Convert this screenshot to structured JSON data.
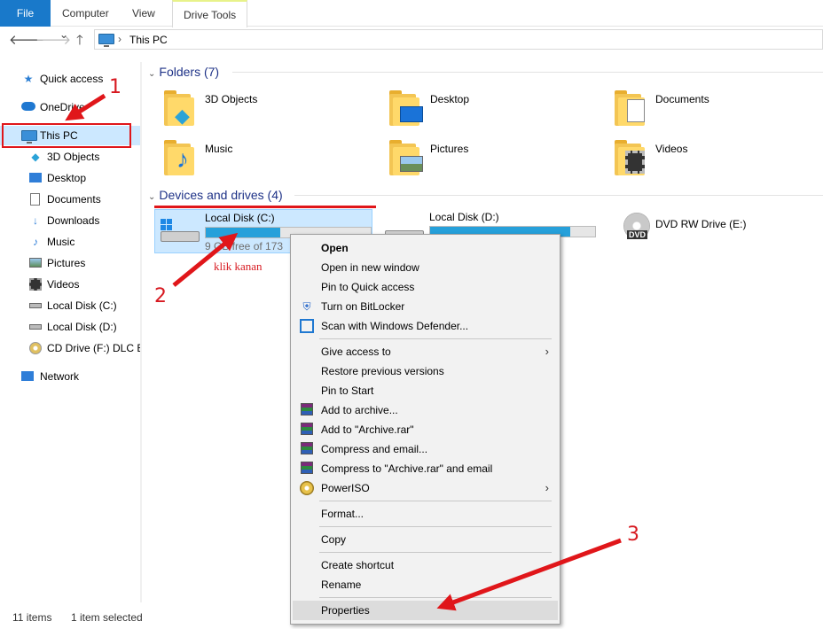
{
  "ribbon": {
    "file": "File",
    "computer": "Computer",
    "view": "View",
    "drive_tools": "Drive Tools"
  },
  "address": {
    "back": "🡐",
    "forward": "🡒",
    "recent": "⌄",
    "up": "🡑",
    "sep": "›",
    "path": "This PC"
  },
  "nav": {
    "quick_access": "Quick access",
    "onedrive": "OneDrive",
    "this_pc": "This PC",
    "items": [
      "3D Objects",
      "Desktop",
      "Documents",
      "Downloads",
      "Music",
      "Pictures",
      "Videos",
      "Local Disk (C:)",
      "Local Disk (D:)",
      "CD Drive (F:) DLC Bo"
    ],
    "network": "Network"
  },
  "folders": {
    "header": "Folders (7)",
    "items": [
      "3D Objects",
      "Desktop",
      "Documents",
      "Music",
      "Pictures",
      "Videos"
    ]
  },
  "drives": {
    "header": "Devices and drives (4)",
    "c": {
      "label": "Local Disk (C:)",
      "free": "9 GB free of 173",
      "fill_fraction": 0.45
    },
    "d": {
      "label": "Local Disk (D:)",
      "fill_fraction": 0.85
    },
    "e": {
      "label": "DVD RW Drive (E:)"
    }
  },
  "annotations": {
    "n1": "1",
    "n2": "2",
    "n3": "3",
    "klik": "klik kanan"
  },
  "context_menu": {
    "open": "Open",
    "open_new_window": "Open in new window",
    "pin_quick": "Pin to Quick access",
    "bitlocker": "Turn on BitLocker",
    "defender": "Scan with Windows Defender...",
    "give_access": "Give access to",
    "restore": "Restore previous versions",
    "pin_start": "Pin to Start",
    "add_archive": "Add to archive...",
    "add_archive_rar": "Add to \"Archive.rar\"",
    "compress_email": "Compress and email...",
    "compress_rar_email": "Compress to \"Archive.rar\" and email",
    "poweriso": "PowerISO",
    "format": "Format...",
    "copy": "Copy",
    "create_shortcut": "Create shortcut",
    "rename": "Rename",
    "properties": "Properties"
  },
  "status": {
    "items": "11 items",
    "selected": "1 item selected"
  },
  "colors": {
    "accent": "#1979ca",
    "selection": "#cce8ff",
    "annotation_red": "#e0161a",
    "header_blue": "#1e3287"
  }
}
